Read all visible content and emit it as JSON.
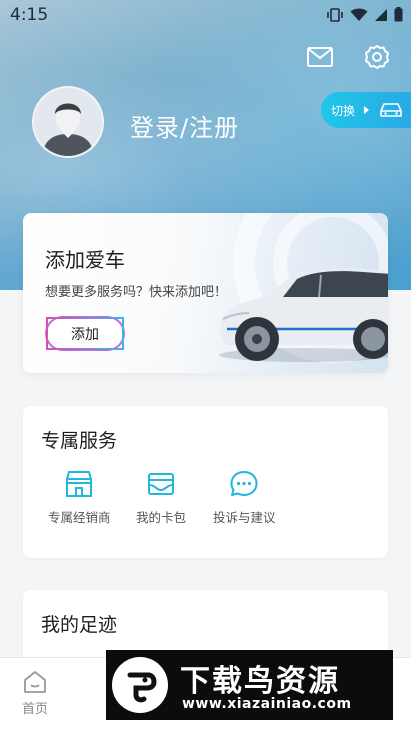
{
  "status_bar": {
    "time": "4:15"
  },
  "header": {
    "login_label": "登录/注册",
    "switch_label": "切换",
    "icons": [
      "mail-icon",
      "settings-gear-icon",
      "car-icon"
    ]
  },
  "add_car": {
    "title": "添加爱车",
    "subtitle": "想要更多服务吗？快来添加吧！",
    "button_label": "添加"
  },
  "services": {
    "title": "专属服务",
    "items": [
      {
        "label": "专属经销商",
        "icon": "store-icon"
      },
      {
        "label": "我的卡包",
        "icon": "card-wallet-icon"
      },
      {
        "label": "投诉与建议",
        "icon": "chat-dots-icon"
      }
    ]
  },
  "footprint": {
    "title": "我的足迹"
  },
  "tabbar": {
    "home_label": "首页"
  },
  "watermark": {
    "title": "下载鸟资源",
    "url": "www.xiazainiao.com"
  },
  "colors": {
    "accent": "#2ba6e6",
    "icon_cyan": "#1fb6e0",
    "button_border": "#8a5de0"
  }
}
